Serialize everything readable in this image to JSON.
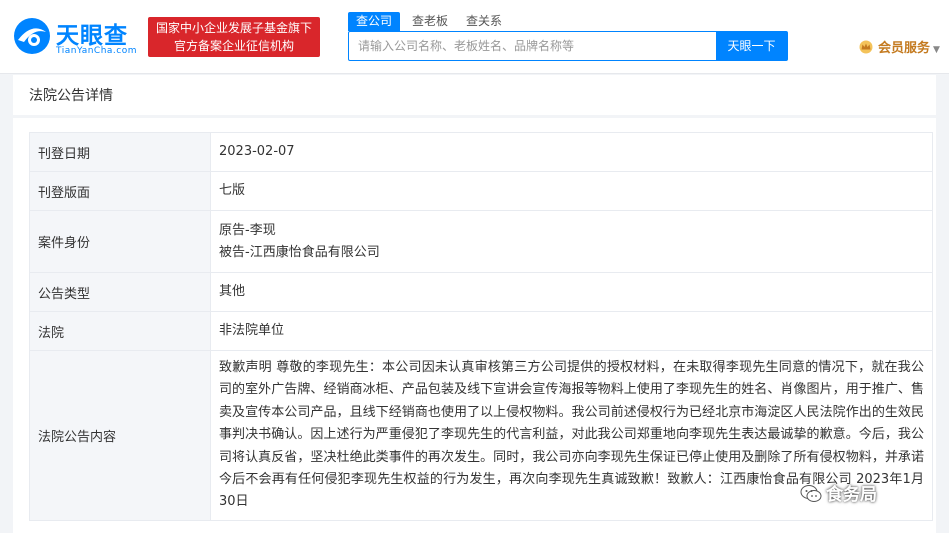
{
  "brand": {
    "name": "天眼查",
    "domain_text": "TianYanCha.com",
    "badge_line1": "国家中小企业发展子基金旗下",
    "badge_line2": "官方备案企业征信机构",
    "primary_color": "#0084ff",
    "badge_color": "#d9262b"
  },
  "search": {
    "tabs": [
      "查公司",
      "查老板",
      "查关系"
    ],
    "active_tab": "查公司",
    "placeholder": "请输入公司名称、老板姓名、品牌名称等",
    "value": "",
    "button_label": "天眼一下"
  },
  "member": {
    "label": "会员服务",
    "icon": "crown-icon"
  },
  "page": {
    "section_title": "法院公告详情"
  },
  "details": {
    "rows": [
      {
        "label": "刊登日期",
        "value": "2023-02-07"
      },
      {
        "label": "刊登版面",
        "value": "七版"
      },
      {
        "label": "案件身份",
        "plaintiff": "原告-李现",
        "defendant": "被告-江西康怡食品有限公司"
      },
      {
        "label": "公告类型",
        "value": "其他"
      },
      {
        "label": "法院",
        "value": "非法院单位"
      },
      {
        "label": "法院公告内容",
        "value": "致歉声明 尊敬的李现先生：本公司因未认真审核第三方公司提供的授权材料，在未取得李现先生同意的情况下，就在我公司的室外广告牌、经销商冰柜、产品包装及线下宣讲会宣传海报等物料上使用了李现先生的姓名、肖像图片，用于推广、售卖及宣传本公司产品，且线下经销商也使用了以上侵权物料。我公司前述侵权行为已经北京市海淀区人民法院作出的生效民事判决书确认。因上述行为严重侵犯了李现先生的代言利益，对此我公司郑重地向李现先生表达最诚挚的歉意。今后，我公司将认真反省，坚决杜绝此类事件的再次发生。同时，我公司亦向李现先生保证已停止使用及删除了所有侵权物料，并承诺今后不会再有任何侵犯李现先生权益的行为发生，再次向李现先生真诚致歉！致歉人：江西康怡食品有限公司 2023年1月30日"
      }
    ]
  },
  "watermark": {
    "text": "食务局",
    "icon": "wechat-icon"
  }
}
